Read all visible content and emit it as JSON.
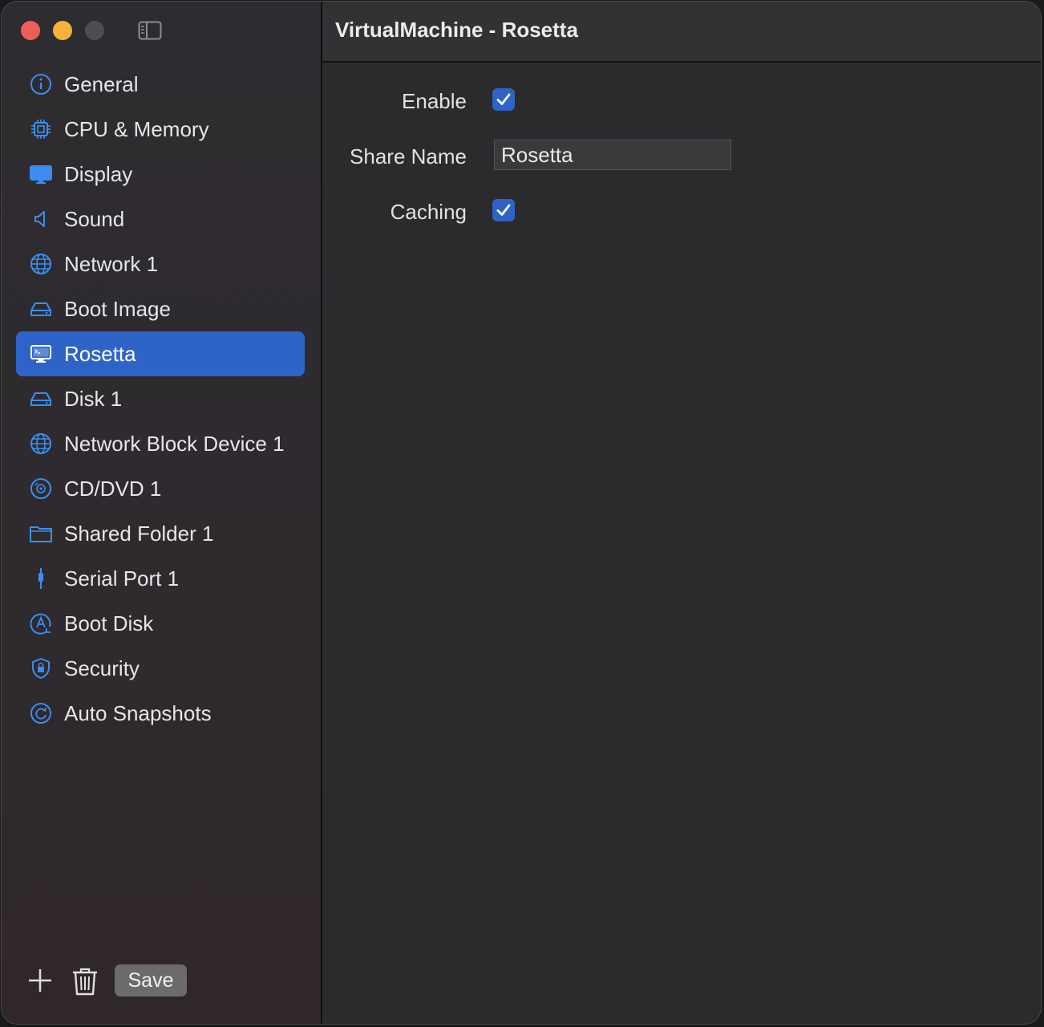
{
  "window": {
    "title": "VirtualMachine - Rosetta"
  },
  "sidebar": {
    "items": [
      {
        "label": "General",
        "icon": "info-circle-icon"
      },
      {
        "label": "CPU & Memory",
        "icon": "cpu-chip-icon"
      },
      {
        "label": "Display",
        "icon": "display-icon"
      },
      {
        "label": "Sound",
        "icon": "speaker-icon"
      },
      {
        "label": "Network 1",
        "icon": "globe-network-icon"
      },
      {
        "label": "Boot Image",
        "icon": "drive-icon"
      },
      {
        "label": "Rosetta",
        "icon": "terminal-monitor-icon",
        "selected": true
      },
      {
        "label": "Disk 1",
        "icon": "drive-icon"
      },
      {
        "label": "Network Block Device 1",
        "icon": "globe-network-icon"
      },
      {
        "label": "CD/DVD 1",
        "icon": "optical-disc-icon"
      },
      {
        "label": "Shared Folder 1",
        "icon": "folder-icon"
      },
      {
        "label": "Serial Port 1",
        "icon": "serial-cable-icon"
      },
      {
        "label": "Boot Disk",
        "icon": "boot-disk-icon"
      },
      {
        "label": "Security",
        "icon": "shield-icon"
      },
      {
        "label": "Auto Snapshots",
        "icon": "clock-arrow-icon"
      }
    ]
  },
  "footer": {
    "save_label": "Save"
  },
  "form": {
    "enable": {
      "label": "Enable",
      "checked": true
    },
    "share_name": {
      "label": "Share Name",
      "value": "Rosetta"
    },
    "caching": {
      "label": "Caching",
      "checked": true
    }
  },
  "colors": {
    "accent": "#2e64c8",
    "icon_blue": "#3b8ef0",
    "close": "#ed5e57",
    "minimize": "#f4b43a"
  }
}
